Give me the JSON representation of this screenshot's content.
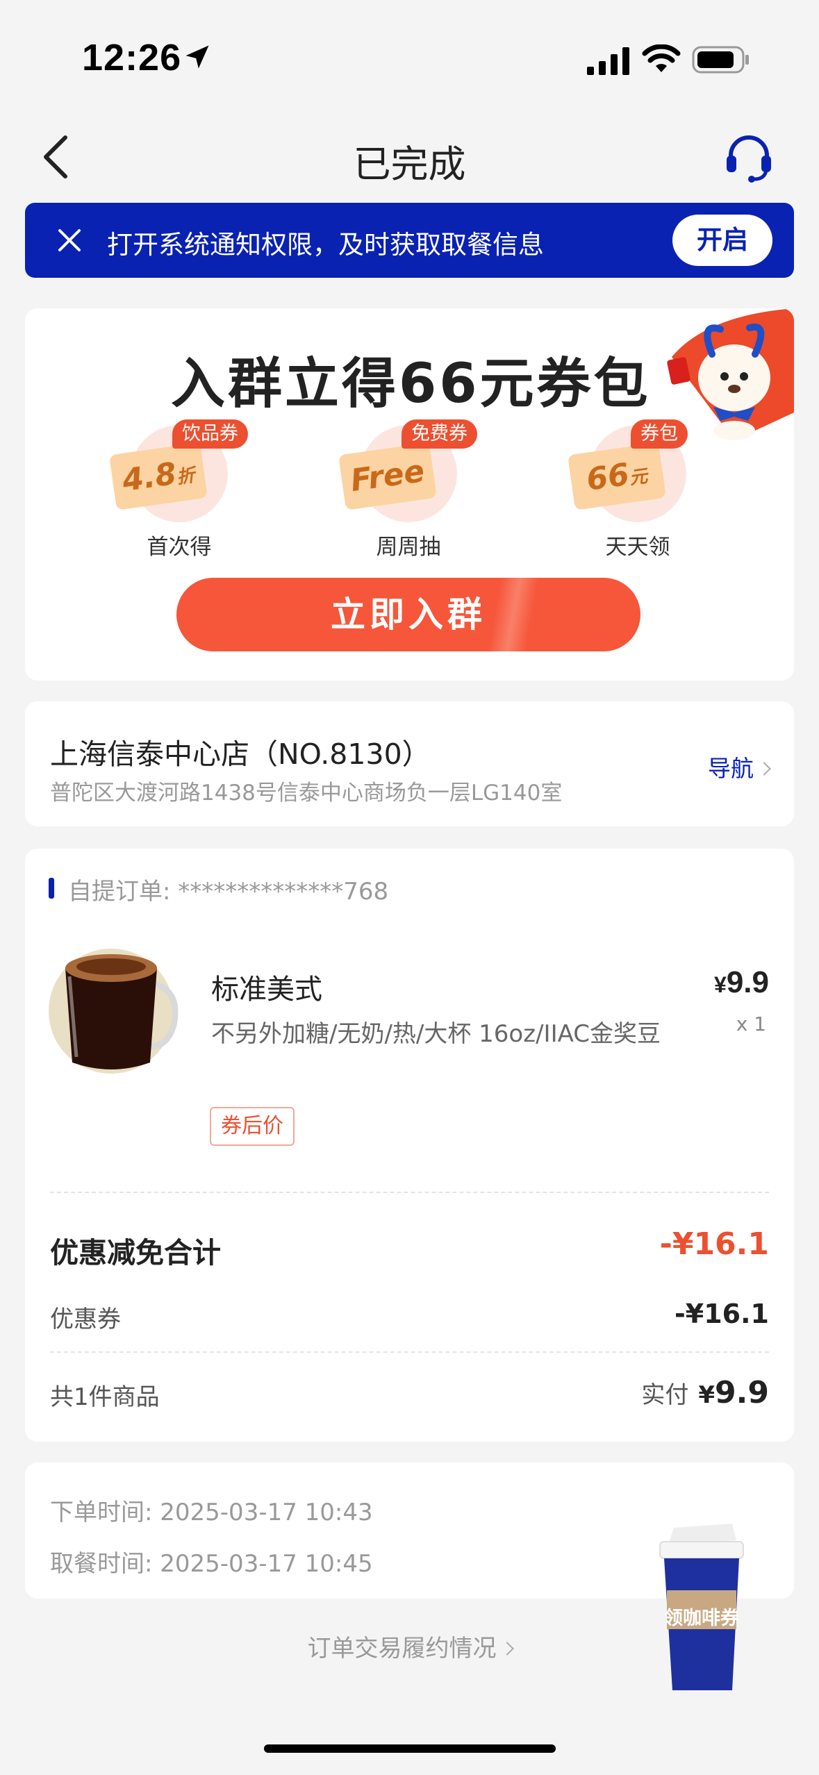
{
  "status_bar": {
    "time": "12:26"
  },
  "nav": {
    "title": "已完成"
  },
  "notice": {
    "text": "打开系统通知权限，及时获取取餐信息",
    "button": "开启"
  },
  "promo": {
    "title": "入群立得66元券包",
    "benefits": [
      {
        "tag": "饮品券",
        "ticket_main": "4.8",
        "ticket_sub": "折",
        "label": "首次得"
      },
      {
        "tag": "免费券",
        "ticket_main": "Free",
        "ticket_sub": "",
        "label": "周周抽"
      },
      {
        "tag": "券包",
        "ticket_main": "66",
        "ticket_sub": "元",
        "label": "天天领"
      }
    ],
    "button": "立即入群"
  },
  "store": {
    "name": "上海信泰中心店（NO.8130）",
    "address": "普陀区大渡河路1438号信泰中心商场负一层LG140室",
    "nav_label": "导航"
  },
  "order": {
    "number": "自提订单: **************768",
    "product": {
      "name": "标准美式",
      "spec": "不另外加糖/无奶/热/大杯 16oz/IIAC金奖豆",
      "currency": "¥",
      "price": "9.9",
      "qty": "x 1",
      "coupon_tag": "券后价"
    },
    "discount_total_label": "优惠减免合计",
    "discount_total_value": "-¥16.1",
    "coupon_label": "优惠券",
    "coupon_value": "-¥16.1",
    "count_label": "共1件商品",
    "paid_label": "实付",
    "paid_currency": "¥",
    "paid_value": "9.9"
  },
  "times": {
    "order_time": "下单时间:  2025-03-17 10:43",
    "pickup_time": "取餐时间:  2025-03-17 10:45"
  },
  "footer": {
    "link": "订单交易履约情况"
  },
  "float": {
    "label": "领咖啡券"
  },
  "colors": {
    "brand_blue": "#0a22b2",
    "accent_orange": "#ec5030",
    "background": "#f4f4f4"
  }
}
